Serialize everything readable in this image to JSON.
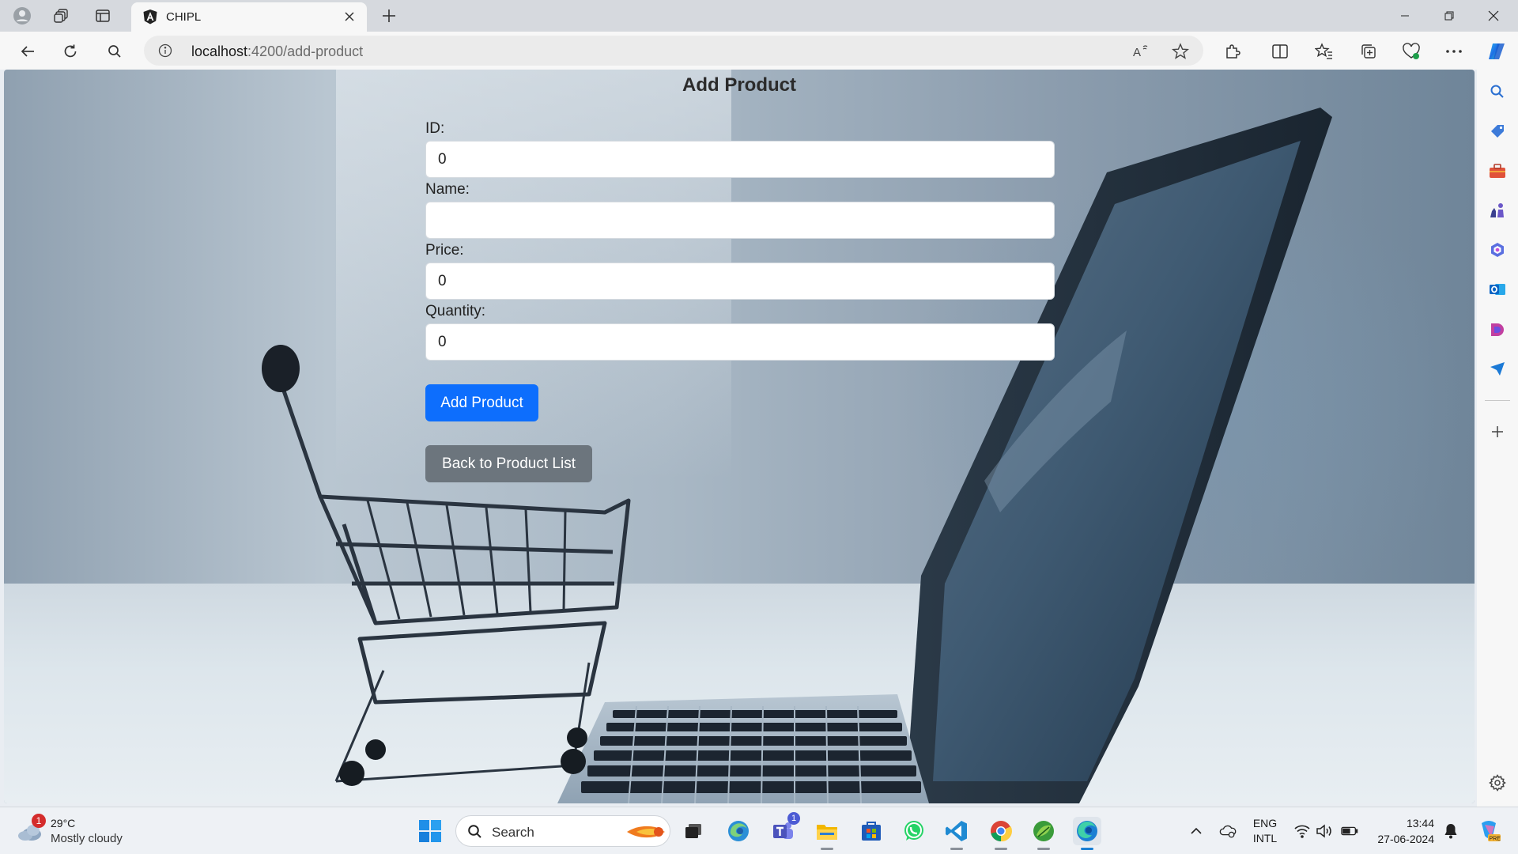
{
  "browser": {
    "tab_title": "CHIPL",
    "url_host": "localhost",
    "url_rest": ":4200/add-product"
  },
  "page": {
    "title": "Add Product",
    "fields": [
      {
        "label": "ID:",
        "value": "0"
      },
      {
        "label": "Name:",
        "value": ""
      },
      {
        "label": "Price:",
        "value": "0"
      },
      {
        "label": "Quantity:",
        "value": "0"
      }
    ],
    "add_button": "Add Product",
    "back_button": "Back to Product List"
  },
  "taskbar": {
    "weather_temp": "29°C",
    "weather_desc": "Mostly cloudy",
    "weather_badge": "1",
    "search_label": "Search",
    "teams_badge": "1",
    "lang_top": "ENG",
    "lang_bottom": "INTL",
    "time": "13:44",
    "date": "27-06-2024"
  },
  "colors": {
    "primary": "#0d6efd",
    "secondary": "#6c757d"
  }
}
